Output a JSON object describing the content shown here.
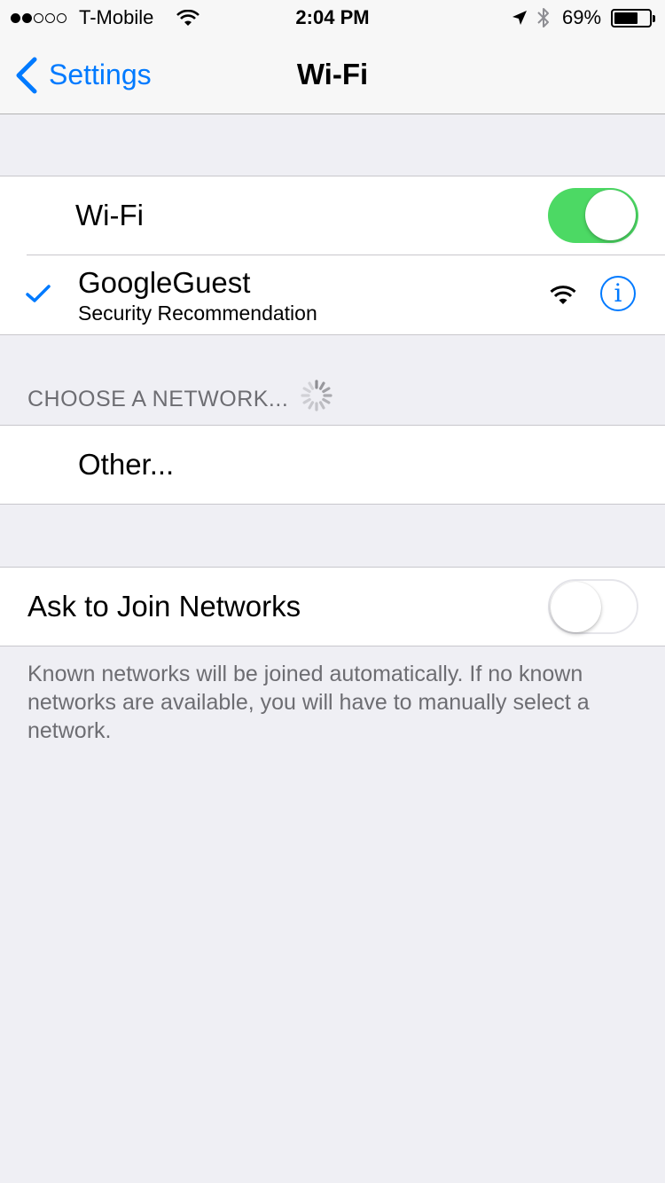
{
  "status_bar": {
    "signal_dots": [
      true,
      true,
      false,
      false,
      false
    ],
    "carrier": "T-Mobile",
    "time": "2:04 PM",
    "battery_percent": "69%",
    "battery_level": 0.69,
    "icons": [
      "wifi-icon",
      "location-arrow-icon",
      "bluetooth-icon",
      "battery-icon"
    ]
  },
  "nav": {
    "back_label": "Settings",
    "title": "Wi-Fi"
  },
  "wifi_group": {
    "wifi_label": "Wi-Fi",
    "wifi_enabled": true,
    "connected_network": {
      "name": "GoogleGuest",
      "subtitle": "Security Recommendation",
      "icons": [
        "checkmark-icon",
        "wifi-signal-icon",
        "info-icon"
      ]
    }
  },
  "choose_section": {
    "header": "CHOOSE A NETWORK...",
    "other_label": "Other..."
  },
  "ask_group": {
    "label": "Ask to Join Networks",
    "enabled": false,
    "footer": "Known networks will be joined automatically. If no known networks are available, you will have to manually select a network."
  },
  "colors": {
    "accent": "#007aff",
    "toggle_on": "#4cd964",
    "background": "#efeff4"
  }
}
